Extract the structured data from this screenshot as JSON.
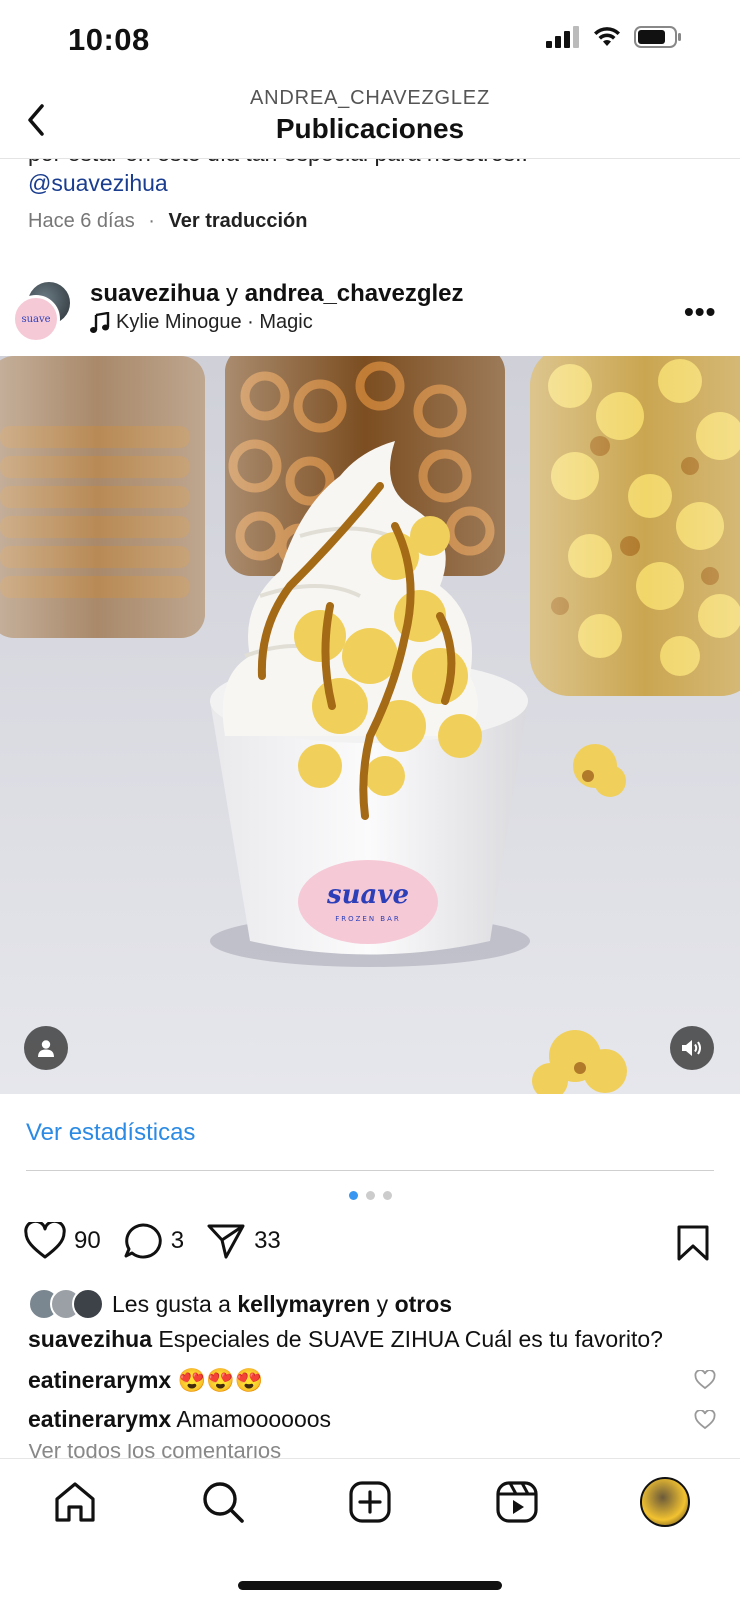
{
  "status": {
    "time": "10:08"
  },
  "header": {
    "username": "ANDREA_CHAVEZGLEZ",
    "title": "Publicaciones"
  },
  "prev_post": {
    "caption_tail": "por estar en este día tan especial para nosotros!!",
    "mention": "@suavezihua",
    "time_ago": "Hace 6 días",
    "separator": "·",
    "translate": "Ver traducción"
  },
  "post": {
    "user1": "suavezihua",
    "joiner": " y ",
    "user2": "andrea_chavezglez",
    "music": "Kylie Minogue · Magic",
    "avatar_logo": "suave",
    "cup_logo": "suave",
    "cup_logo_sub": "FROZEN BAR",
    "insights": "Ver estadísticas",
    "carousel": {
      "count": 3,
      "active": 0
    },
    "likes_count": "90",
    "comments_count": "3",
    "shares_count": "33",
    "liked_by_prefix": "Les gusta a ",
    "liked_by_user": "kellymayren",
    "liked_by_joiner": " y ",
    "liked_by_others": "otros",
    "caption_user": "suavezihua",
    "caption_text": " Especiales de SUAVE ZIHUA Cuál es tu favorito?",
    "comments": [
      {
        "user": "eatinerarymx",
        "text": " 😍😍😍"
      },
      {
        "user": "eatinerarymx",
        "text": " Amamoooooos"
      }
    ],
    "view_all": "Ver todos los comentarios"
  },
  "nav": [
    "home-icon",
    "search-icon",
    "create-icon",
    "reels-icon",
    "profile-avatar"
  ],
  "colors": {
    "link": "#2b8ae4",
    "mention": "#1a3d8f",
    "cup_badge": "#f6c9d6",
    "logo_blue": "#2c3fb8"
  }
}
